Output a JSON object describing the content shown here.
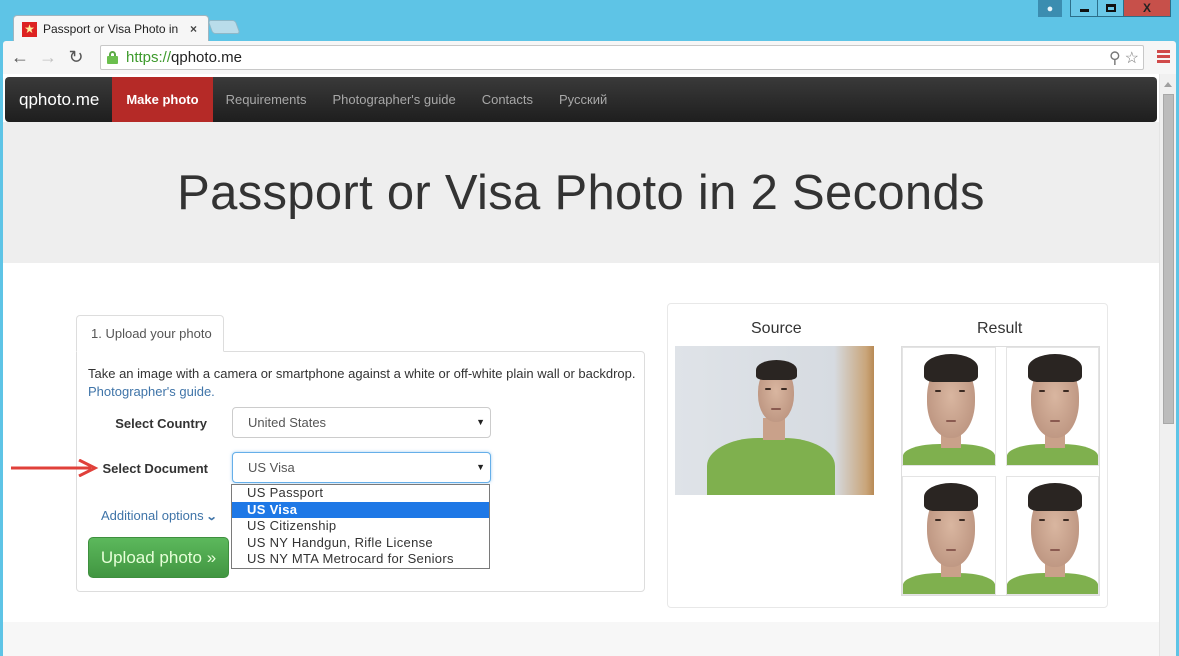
{
  "window": {
    "controls": {
      "minimize": "minimize",
      "maximize": "maximize",
      "close": "X"
    }
  },
  "browser": {
    "tab_title": "Passport or Visa Photo in",
    "tab_close": "×",
    "url_scheme": "https://",
    "url_host": "qphoto.me",
    "icons": [
      "back-arrow-icon",
      "forward-arrow-icon",
      "reload-icon",
      "lock-icon",
      "zoom-icon",
      "star-icon",
      "menu-icon"
    ]
  },
  "navbar": {
    "brand": "qphoto.me",
    "items": [
      {
        "label": "Make photo",
        "active": true
      },
      {
        "label": "Requirements",
        "active": false
      },
      {
        "label": "Photographer's guide",
        "active": false
      },
      {
        "label": "Contacts",
        "active": false
      },
      {
        "label": "Русский",
        "active": false
      }
    ]
  },
  "hero": {
    "title": "Passport or Visa Photo in 2 Seconds"
  },
  "form": {
    "tab_label": "1. Upload your photo",
    "instructions": "Take an image with a camera or smartphone against a white or off-white plain wall or backdrop.",
    "guide_link": "Photographer's guide.",
    "country_label": "Select Country",
    "country_value": "United States",
    "document_label": "Select Document",
    "document_value": "US Visa",
    "document_options": [
      {
        "label": "US Passport",
        "selected": false
      },
      {
        "label": "US Visa",
        "selected": true
      },
      {
        "label": "US Citizenship",
        "selected": false
      },
      {
        "label": "US NY Handgun, Rifle License",
        "selected": false
      },
      {
        "label": "US NY MTA Metrocard for Seniors",
        "selected": false
      }
    ],
    "additional_options": "Additional options",
    "upload_button": "Upload photo »"
  },
  "preview": {
    "source_title": "Source",
    "result_title": "Result",
    "result_count": 4
  },
  "colors": {
    "accent_red": "#b52a27",
    "upload_green": "#4cae4c",
    "link_blue": "#3f74a8",
    "selected_option": "#1e78e6",
    "annotation_arrow": "#e0403a"
  },
  "caret_glyph": "▼"
}
